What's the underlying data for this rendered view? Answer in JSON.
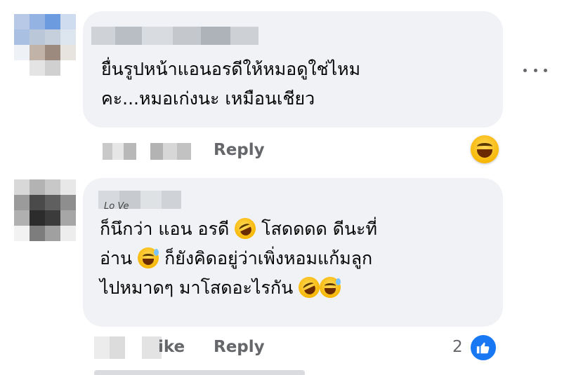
{
  "comments": [
    {
      "text_lines": [
        "ยื่นรูปหน้าแอนอรดีให้หมอดูใช่ไหม",
        "คะ...หมอเก่งนะ เหมือนเชียว"
      ],
      "actions": {
        "reply_label": "Reply"
      },
      "reaction_icon": "grinning-face-icon"
    },
    {
      "author_fragment": "Lo Ve",
      "text_lines": [
        "ก็นึกว่า แอน อรดี",
        "โสดดดด ดีนะที่",
        "อ่าน",
        "ก็ยังคิดอยู่ว่าเพิ่งหอมแก้มลูก",
        "ไปหมาดๆ มาโสดอะไรกัน"
      ],
      "actions": {
        "like_fragment": "ike",
        "reply_label": "Reply"
      },
      "reaction_count": "2",
      "reaction_icon": "like-thumb-icon"
    }
  ],
  "colors": {
    "bubble": "#f0f2f5",
    "text": "#050505",
    "secondary": "#65676b",
    "like_blue": "#1877f2"
  }
}
